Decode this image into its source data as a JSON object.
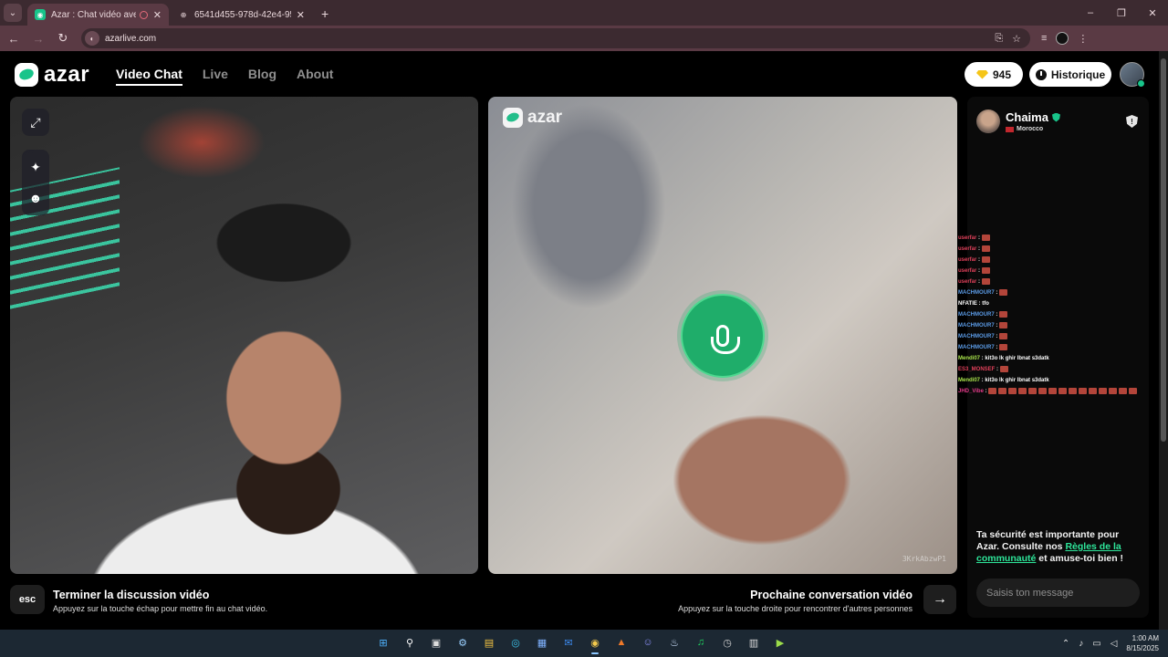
{
  "browser": {
    "tabs": [
      {
        "title": "Azar : Chat vidéo avec de n",
        "active": true
      },
      {
        "title": "6541d455-978d-42e4-95a3-fb",
        "active": false
      }
    ],
    "new_tab": "+",
    "url": "azarlive.com",
    "window_controls": {
      "minimize": "–",
      "maximize": "❐",
      "close": "✕"
    }
  },
  "header": {
    "logo_text": "azar",
    "nav": [
      {
        "label": "Video Chat",
        "active": true
      },
      {
        "label": "Live",
        "active": false
      },
      {
        "label": "Blog",
        "active": false
      },
      {
        "label": "About",
        "active": false
      }
    ],
    "gems": "945",
    "history_label": "Historique"
  },
  "video_right": {
    "watermark": "azar",
    "video_id": "3KrkAbzwP1"
  },
  "chat": {
    "peer_name": "Chaima",
    "peer_country": "Morocco",
    "report_glyph": "!",
    "safety_prefix": "Ta sécurité est importante pour Azar. Consulte nos ",
    "safety_link": "Règles de la communauté",
    "safety_suffix": " et amuse-toi bien !",
    "input_placeholder": "Saisis ton message"
  },
  "overlay_chat": [
    {
      "user": "userfar",
      "text": "",
      "color": "red",
      "emotes": 1
    },
    {
      "user": "userfar",
      "text": "",
      "color": "red",
      "emotes": 1
    },
    {
      "user": "userfar",
      "text": "",
      "color": "red",
      "emotes": 1
    },
    {
      "user": "userfar",
      "text": "",
      "color": "red",
      "emotes": 1
    },
    {
      "user": "userfar",
      "text": "",
      "color": "red",
      "emotes": 1
    },
    {
      "user": "MACHMOUR7",
      "text": "",
      "color": "blue",
      "emotes": 1
    },
    {
      "user": "NFATIE",
      "text": "tfo",
      "color": "white",
      "emotes": 0
    },
    {
      "user": "MACHMOUR7",
      "text": "",
      "color": "blue",
      "emotes": 1
    },
    {
      "user": "MACHMOUR7",
      "text": "",
      "color": "blue",
      "emotes": 1
    },
    {
      "user": "MACHMOUR7",
      "text": "",
      "color": "blue",
      "emotes": 1
    },
    {
      "user": "MACHMOUR7",
      "text": "",
      "color": "blue",
      "emotes": 1
    },
    {
      "user": "Mendi07",
      "text": "kit3o lk ghir lbnat s3datk",
      "color": "green",
      "emotes": 0
    },
    {
      "user": "ES3_MONSEF",
      "text": "",
      "color": "red",
      "emotes": 1
    },
    {
      "user": "Mendi07",
      "text": "kit3o lk ghir lbnat s3datk",
      "color": "green",
      "emotes": 0
    },
    {
      "user": "JHD_Vibe",
      "text": "",
      "color": "pink",
      "emotes": 15
    }
  ],
  "bottom": {
    "esc_key": "esc",
    "end_title": "Terminer la discussion vidéo",
    "end_sub": "Appuyez sur la touche échap pour mettre fin au chat vidéo.",
    "next_title": "Prochaine conversation vidéo",
    "next_sub": "Appuyez sur la touche droite pour rencontrer d'autres personnes",
    "arrow_key": "→"
  },
  "taskbar": {
    "time": "1:00 AM",
    "date": "8/15/2025"
  },
  "colors": {
    "accent": "#18c48a",
    "mic": "#1fad6a",
    "rules_link": "#2ee59a"
  }
}
